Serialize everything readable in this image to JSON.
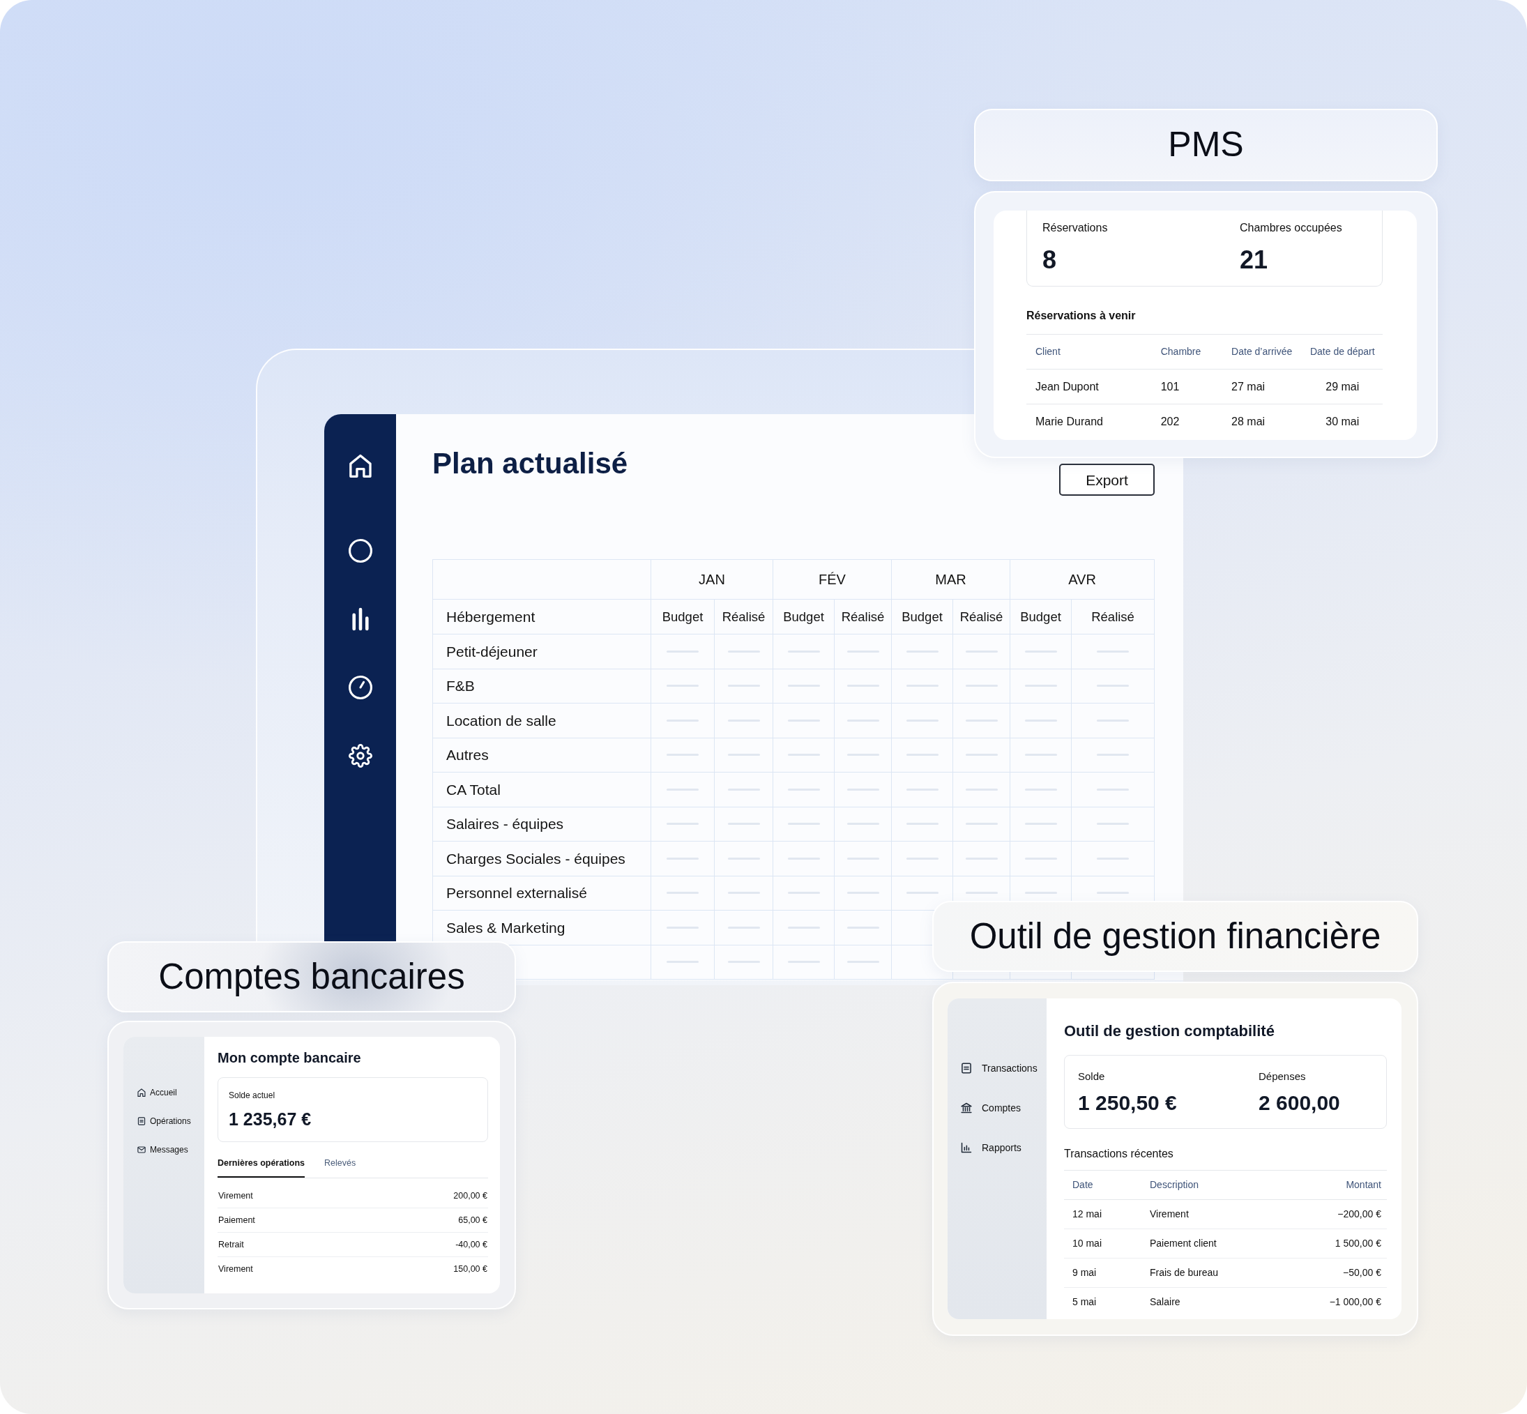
{
  "plan": {
    "title": "Plan actualisé",
    "export_button": "Export",
    "table": {
      "months": [
        "JAN",
        "FÉV",
        "MAR",
        "AVR"
      ],
      "rows": [
        {
          "label": "Hébergement",
          "kind": "subheader",
          "cells": [
            "Budget",
            "Réalisé",
            "Budget",
            "Réalisé",
            "Budget",
            "Réalisé",
            "Budget",
            "Réalisé"
          ]
        },
        {
          "label": "Petit-déjeuner",
          "kind": "blank"
        },
        {
          "label": "F&B",
          "kind": "blank"
        },
        {
          "label": "Location de salle",
          "kind": "blank"
        },
        {
          "label": "Autres",
          "kind": "blank"
        },
        {
          "label": "CA Total",
          "kind": "blank"
        },
        {
          "label": "Salaires - équipes",
          "kind": "blank"
        },
        {
          "label": "Charges Sociales - équipes",
          "kind": "blank"
        },
        {
          "label": "Personnel externalisé",
          "kind": "blank"
        },
        {
          "label": "Sales & Marketing",
          "kind": "blank"
        },
        {
          "kind": "blank"
        }
      ]
    }
  },
  "pms": {
    "heading": "PMS",
    "stats": [
      {
        "label": "Réservations",
        "value": "8"
      },
      {
        "label": "Chambres occupées",
        "value": "21"
      }
    ],
    "section_title": "Réservations à venir",
    "table": {
      "columns": [
        "Client",
        "Chambre",
        "Date d’arrivée",
        "Date de départ"
      ],
      "rows": [
        [
          "Jean Dupont",
          "101",
          "27 mai",
          "29 mai"
        ],
        [
          "Marie Durand",
          "202",
          "28 mai",
          "30 mai"
        ]
      ]
    }
  },
  "bank": {
    "heading": "Comptes bancaires",
    "sidebar": {
      "items": [
        {
          "label": "Accueil"
        },
        {
          "label": "Opérations"
        },
        {
          "label": "Messages"
        }
      ]
    },
    "title": "Mon compte bancaire",
    "balance": {
      "label": "Solde actuel",
      "value": "1 235,67 €"
    },
    "tabs": [
      {
        "label": "Dernières opérations",
        "selected": true
      },
      {
        "label": "Relevés",
        "selected": false
      }
    ],
    "operations": [
      {
        "label": "Virement",
        "amount": "200,00 €"
      },
      {
        "label": "Paiement",
        "amount": "65,00 €"
      },
      {
        "label": "Retrait",
        "amount": "-40,00 €"
      },
      {
        "label": "Virement",
        "amount": "150,00 €"
      }
    ]
  },
  "finance": {
    "heading": "Outil de gestion financière",
    "sidebar": {
      "items": [
        {
          "label": "Transactions"
        },
        {
          "label": "Comptes"
        },
        {
          "label": "Rapports"
        }
      ]
    },
    "title": "Outil de gestion comptabilité",
    "stats": [
      {
        "label": "Solde",
        "value": "1 250,50 €"
      },
      {
        "label": "Dépenses",
        "value": "2 600,00"
      }
    ],
    "section_title": "Transactions récentes",
    "table": {
      "columns": [
        "Date",
        "Description",
        "Montant"
      ],
      "rows": [
        [
          "12 mai",
          "Virement",
          "−200,00 €"
        ],
        [
          "10 mai",
          "Paiement client",
          "1 500,00 €"
        ],
        [
          "9 mai",
          "Frais de bureau",
          "−50,00 €"
        ],
        [
          "5 mai",
          "Salaire",
          "−1 000,00 €"
        ]
      ]
    }
  }
}
